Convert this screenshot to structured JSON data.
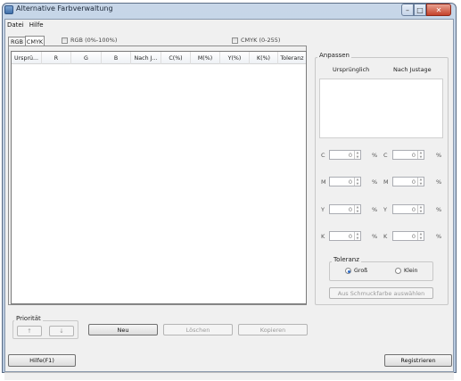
{
  "window": {
    "title": "Alternative Farbverwaltung"
  },
  "menu": [
    "Datei",
    "Hilfe"
  ],
  "tabs": [
    "RGB",
    "CMYK"
  ],
  "options": {
    "rgb_percent": "RGB (0%-100%)",
    "cmyk_range": "CMYK (0-255)"
  },
  "list": {
    "columns": [
      "Ursprü...",
      "R",
      "G",
      "B",
      "Nach J...",
      "C(%)",
      "M(%)",
      "Y(%)",
      "K(%)",
      "Toleranz"
    ]
  },
  "anpassen": {
    "label": "Anpassen",
    "col_original": "Ursprünglich",
    "col_adjusted": "Nach Justage",
    "rows": [
      {
        "label": "C",
        "value_left": "0",
        "value_right": "0",
        "unit": "%"
      },
      {
        "label": "M",
        "value_left": "0",
        "value_right": "0",
        "unit": "%"
      },
      {
        "label": "Y",
        "value_left": "0",
        "value_right": "0",
        "unit": "%"
      },
      {
        "label": "K",
        "value_left": "0",
        "value_right": "0",
        "unit": "%"
      }
    ],
    "toleranz": {
      "label": "Toleranz",
      "gross": "Groß",
      "klein": "Klein",
      "selected": "Groß"
    },
    "spot_button": "Aus Schmuckfarbe auswählen"
  },
  "prioritaet": {
    "label": "Priorität",
    "up": "↑",
    "down": "↓"
  },
  "buttons": {
    "neu": "Neu",
    "loeschen": "Löschen",
    "kopieren": "Kopieren",
    "help": "Hilfe(F1)",
    "register": "Registrieren"
  }
}
